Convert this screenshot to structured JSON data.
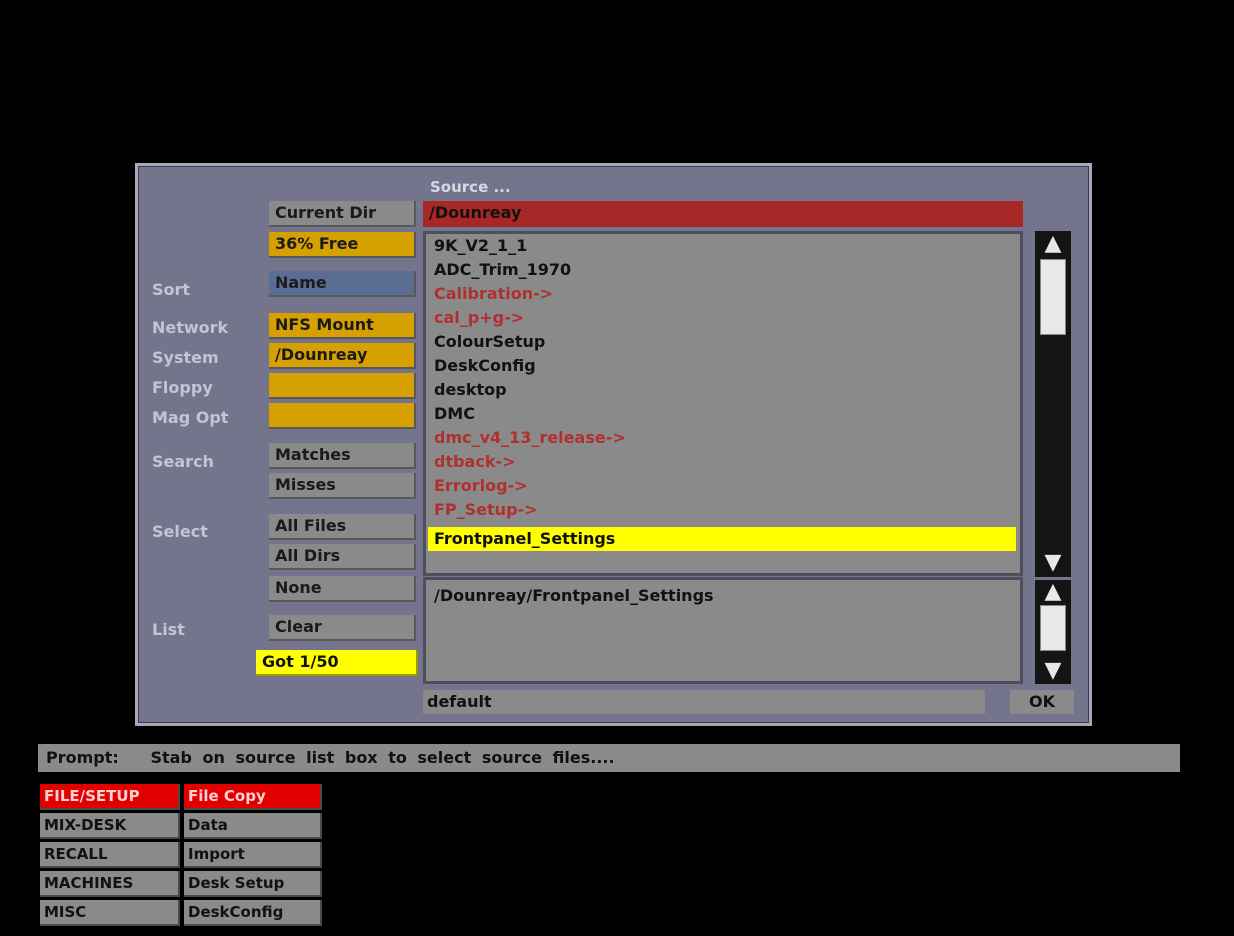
{
  "dialog": {
    "source_heading": "Source ...",
    "current_dir_label": "Current Dir",
    "current_dir_value": "/Dounreay",
    "free_space": "36% Free",
    "sort_label": "Sort",
    "sort_value": "Name",
    "network_label": "Network",
    "network_value": "NFS Mount",
    "system_label": "System",
    "system_value": "/Dounreay",
    "floppy_label": "Floppy",
    "floppy_value": "",
    "magopt_label": "Mag Opt",
    "magopt_value": "",
    "search_label": "Search",
    "search_matches": "Matches",
    "search_misses": "Misses",
    "select_label": "Select",
    "select_all_files": "All Files",
    "select_all_dirs": "All Dirs",
    "select_none": "None",
    "list_label": "List",
    "list_clear": "Clear",
    "list_status": "Got 1/50",
    "files": [
      {
        "name": "9K_V2_1_1",
        "type": "file"
      },
      {
        "name": "ADC_Trim_1970",
        "type": "file"
      },
      {
        "name": "Calibration->",
        "type": "dir"
      },
      {
        "name": "cal_p+g->",
        "type": "dir"
      },
      {
        "name": "ColourSetup",
        "type": "file"
      },
      {
        "name": "DeskConfig",
        "type": "file"
      },
      {
        "name": "desktop",
        "type": "file"
      },
      {
        "name": "DMC",
        "type": "file"
      },
      {
        "name": "dmc_v4_13_release->",
        "type": "dir"
      },
      {
        "name": "dtback->",
        "type": "dir"
      },
      {
        "name": "Errorlog->",
        "type": "dir"
      },
      {
        "name": "FP_Setup->",
        "type": "dir"
      },
      {
        "name": "Frontpanel_Settings",
        "type": "file",
        "selected": true
      }
    ],
    "selected_path": "/Dounreay/Frontpanel_Settings",
    "filter_value": "default",
    "ok_label": "OK"
  },
  "prompt": {
    "label": "Prompt:",
    "text": "Stab on source list box to select source files...."
  },
  "menu": {
    "categories": [
      "FILE/SETUP",
      "MIX-DESK",
      "RECALL",
      "MACHINES",
      "MISC"
    ],
    "subitems": [
      "File Copy",
      "Data",
      "Import",
      "Desk Setup",
      "DeskConfig"
    ],
    "active_category": "FILE/SETUP",
    "active_subitem": "File Copy"
  },
  "colors": {
    "dialog_bg": "#74748c",
    "highlight_yellow": "#ffff00",
    "directory_red": "#b03030",
    "active_menu_red": "#e00000",
    "status_orange": "#d6a000"
  }
}
